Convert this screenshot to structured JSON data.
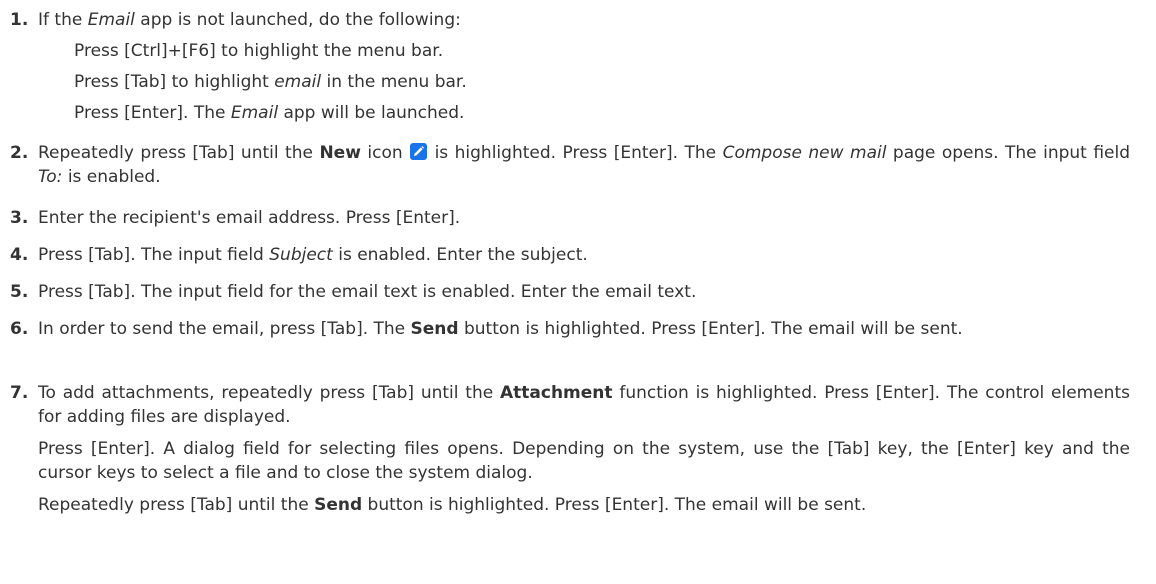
{
  "steps": [
    {
      "number": "1.",
      "intro": {
        "a": "If the ",
        "app": "Email",
        "b": " app is not launched, do the following:"
      },
      "sub1": "Press [Ctrl]+[F6] to highlight the menu bar.",
      "sub2": {
        "a": "Press [Tab] to highlight ",
        "word": "email",
        "b": " in the menu bar."
      },
      "sub3": {
        "a": "Press [Enter]. The ",
        "app": "Email",
        "b": " app will be launched."
      }
    },
    {
      "number": "2.",
      "a": "Repeatedly press [Tab] until the ",
      "bold": "New",
      "b": " icon ",
      "icon": "pencil-edit-icon",
      "icon_color": "#1a73e8",
      "c": " is highlighted. Press [Enter]. The ",
      "page": "Compose new mail",
      "d": " page opens. The input field ",
      "field": "To:",
      "e": " is enabled."
    },
    {
      "number": "3.",
      "text": "Enter the recipient's email address. Press [Enter]."
    },
    {
      "number": "4.",
      "a": "Press [Tab]. The input field ",
      "field": "Subject",
      "b": " is enabled. Enter the subject."
    },
    {
      "number": "5.",
      "text": "Press [Tab]. The input field for the email text is enabled. Enter the email text."
    },
    {
      "number": "6.",
      "a": "In order to send the email, press [Tab]. The ",
      "bold": "Send",
      "b": " button is highlighted. Press [Enter]. The email will be sent."
    },
    {
      "number": "7.",
      "a": "To add attachments, repeatedly press [Tab] until the ",
      "bold": "Attachment",
      "b": " function is highlighted. Press [Enter]. The control elements for adding files are displayed.",
      "p2": "Press [Enter]. A dialog field for selecting files opens. Depending on the system, use the [Tab] key, the [Enter] key and the cursor keys to select a file and to close the system dialog.",
      "p3a": "Repeatedly press [Tab] until the ",
      "p3bold": "Send",
      "p3b": " button is highlighted. Press [Enter]. The email will be sent."
    }
  ]
}
